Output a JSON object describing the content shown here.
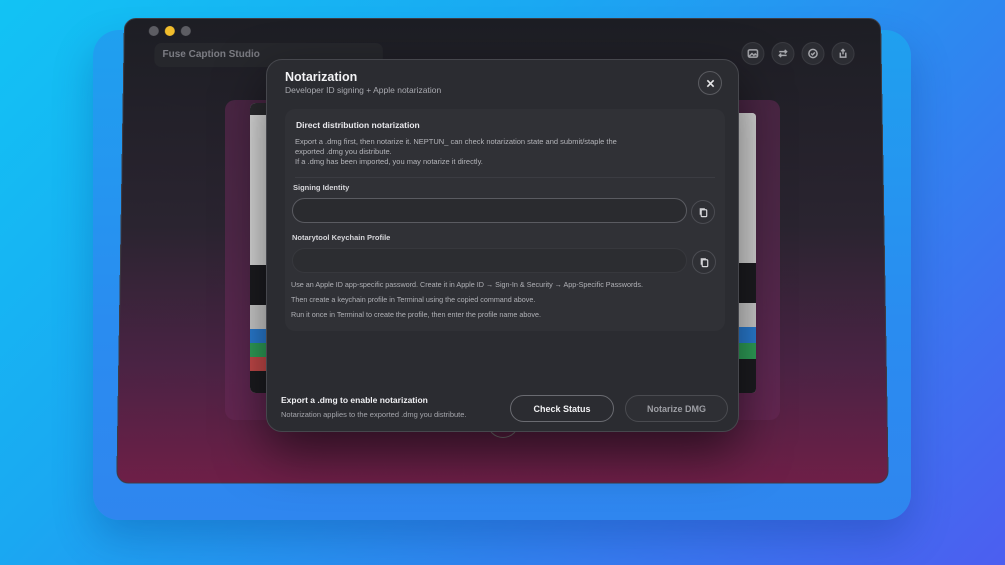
{
  "window": {
    "title_field": "Fuse Caption Studio",
    "toolbar_icons": [
      "image-icon",
      "swap-icon",
      "check-circle-icon",
      "export-icon"
    ]
  },
  "modal": {
    "title": "Notarization",
    "subtitle": "Developer ID signing + Apple notarization",
    "close_icon": "close-icon",
    "card": {
      "title": "Direct distribution notarization",
      "description_line1": "Export a .dmg first, then notarize it. NEPTUN_ can check notarization state and submit/staple the",
      "description_line2": "exported .dmg you distribute.",
      "description_line3": "If a .dmg has been imported, you may notarize it directly."
    },
    "signing_identity": {
      "label": "Signing Identity",
      "value": "",
      "placeholder": "",
      "copy_icon": "copy-icon"
    },
    "keychain_profile": {
      "label": "Notarytool Keychain Profile",
      "value": "",
      "placeholder": "",
      "copy_icon": "copy-icon"
    },
    "help": {
      "line1": "Use an Apple ID app-specific password. Create it in Apple ID → Sign-In & Security → App-Specific Passwords.",
      "line2": "Then create a keychain profile in Terminal using the copied command above.",
      "line3": "Run it once in Terminal to create the profile, then enter the profile name above."
    },
    "footer": {
      "status_title": "Export a .dmg to enable notarization",
      "status_sub": "Notarization applies to the exported .dmg you distribute.",
      "check_status_label": "Check Status",
      "notarize_label": "Notarize DMG"
    }
  }
}
